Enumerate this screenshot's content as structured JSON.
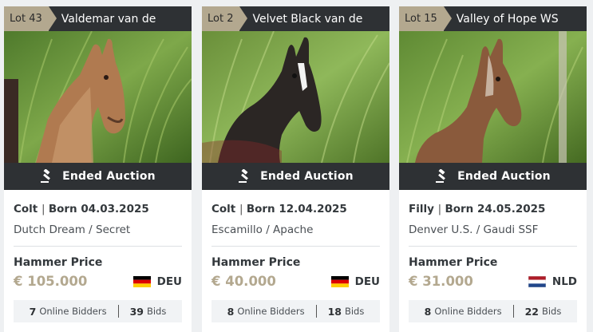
{
  "cards": [
    {
      "lot": "Lot 43",
      "name": "Valdemar van de",
      "status": "Ended Auction",
      "sex": "Colt",
      "born": "Born 04.03.2025",
      "pedigree": "Dutch Dream / Secret",
      "hammer_label": "Hammer Price",
      "price": "€ 105.000",
      "country": "DEU",
      "online_bidders_count": "7",
      "online_bidders_label": "Online Bidders",
      "bids_count": "39",
      "bids_label": "Bids"
    },
    {
      "lot": "Lot 2",
      "name": "Velvet Black van de",
      "status": "Ended Auction",
      "sex": "Colt",
      "born": "Born 12.04.2025",
      "pedigree": "Escamillo / Apache",
      "hammer_label": "Hammer Price",
      "price": "€ 40.000",
      "country": "DEU",
      "online_bidders_count": "8",
      "online_bidders_label": "Online Bidders",
      "bids_count": "18",
      "bids_label": "Bids"
    },
    {
      "lot": "Lot 15",
      "name": "Valley of Hope WS",
      "status": "Ended Auction",
      "sex": "Filly",
      "born": "Born 24.05.2025",
      "pedigree": "Denver U.S. / Gaudi SSF",
      "hammer_label": "Hammer Price",
      "price": "€ 31.000",
      "country": "NLD",
      "online_bidders_count": "8",
      "online_bidders_label": "Online Bidders",
      "bids_count": "22",
      "bids_label": "Bids"
    }
  ],
  "colors": {
    "accent": "#b3a88f",
    "dark_bar": "#2e3134"
  },
  "icons": {
    "status": "gavel-icon",
    "flag_deu": "germany-flag-icon",
    "flag_nld": "netherlands-flag-icon"
  }
}
